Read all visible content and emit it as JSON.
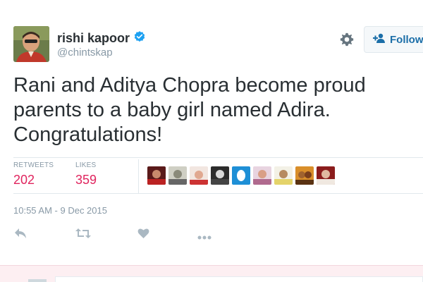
{
  "author": {
    "name": "rishi kapoor",
    "handle": "@chintskap",
    "verified": true
  },
  "header": {
    "follow_label": "Follow",
    "settings_icon": "gear-icon",
    "follow_icon": "add-user-icon"
  },
  "tweet": {
    "text": "Rani and Aditya Chopra become proud parents to a baby girl named Adira. Congratulations!",
    "timestamp": "10:55 AM - 9 Dec 2015"
  },
  "stats": {
    "retweets_label": "RETWEETS",
    "retweets_count": "202",
    "likes_label": "LIKES",
    "likes_count": "359"
  },
  "liker_avatars": [
    "avatar-1",
    "avatar-2",
    "avatar-3",
    "avatar-4",
    "avatar-5",
    "avatar-6",
    "avatar-7",
    "avatar-8",
    "avatar-9"
  ],
  "actions": [
    "reply-icon",
    "retweet-icon",
    "like-icon",
    "more-icon"
  ],
  "colors": {
    "text": "#292f33",
    "muted": "#8899a6",
    "count": "#e0245e",
    "verified": "#1da1f2",
    "follow": "#1b6ea8",
    "border": "#e1e8ed"
  }
}
